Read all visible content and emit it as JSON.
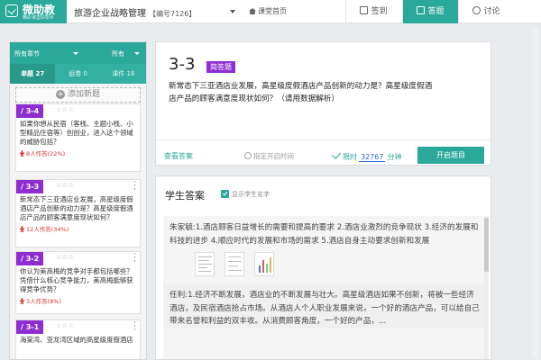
{
  "app": {
    "name": "微助教",
    "tagline": "精彩课堂好帮手"
  },
  "header": {
    "course_name": "旅游企业战略管理",
    "course_code": "【编号7126】",
    "home_link": "课堂首页",
    "tabs": [
      {
        "label": "签到",
        "active": false,
        "icon": "checkin-icon"
      },
      {
        "label": "答题",
        "active": true,
        "icon": "quiz-icon"
      },
      {
        "label": "讨论",
        "active": false,
        "icon": "discussion-icon"
      }
    ]
  },
  "sidebar": {
    "filter_chapter": "所有章节",
    "filter_all": "所有",
    "counts": [
      {
        "label": "单题 27",
        "active": true
      },
      {
        "label": "组卷 0",
        "active": false
      },
      {
        "label": "课件 18",
        "active": false
      }
    ],
    "add_new": "添加新题",
    "cards": [
      {
        "tag": "3-4",
        "stars": "☆☆☆",
        "text": "如果你想从民宿（客栈、主题小栈、小型精品住宿等）创创业，进入这个领域的威胁包括？",
        "stat": "8人作答(22%)"
      },
      {
        "tag": "3-3",
        "stars": "☆☆☆",
        "text": "新常态下三亚酒店业发展，高星级度假酒店产品创新的动力是？高星级度假酒店产品的顾客满意度现状如何？",
        "stat": "12人作答(34%)"
      },
      {
        "tag": "3-2",
        "stars": "☆☆☆",
        "text": "你认为美高梅的竞争对手都包括哪些？凭借什么核心竞争能力，美高梅能够获得竞争优势？",
        "stat": "3人作答(8%)"
      },
      {
        "tag": "3-1",
        "stars": "☆☆☆",
        "text": "海棠湾、亚龙湾区域的高星级度假酒店",
        "stat": ""
      }
    ]
  },
  "question": {
    "number": "3-3",
    "type": "简答题",
    "text": "新常态下三亚酒店业发展，高星级度假酒店产品创新的动力是？高星级度假酒店产品的顾客满意度现状如何？（请用数据解析）",
    "view_answer": "查看答案",
    "end_time_label": "指定开启时间",
    "limit_label": "限时",
    "limit_minutes": "32767",
    "limit_unit": "分钟",
    "start_button": "开启题目"
  },
  "answers": {
    "title": "学生答案",
    "show_names_label": "显示学生名字",
    "items": [
      {
        "name": "朱家毓:",
        "text": "1.酒店顾客日益增长的需要和提高的要求 2.酒店业激烈的竞争现状 3.经济的发展和科技的进步 4.顺应时代的发展和市场的需求 5.酒店自身主动要求创新和发展"
      },
      {
        "name": "任利:",
        "text": "1.经济不断发展，酒店业的不断发展与壮大。高星级酒店如果不创新，将被一些经济酒店，及民宿酒店抢占市场。从酒店人个人职业发展来说，一个好的酒店产品，可以给自己带来名誉和利益的双丰收。从消费顾客角度，一个好的产品，..."
      }
    ]
  }
}
